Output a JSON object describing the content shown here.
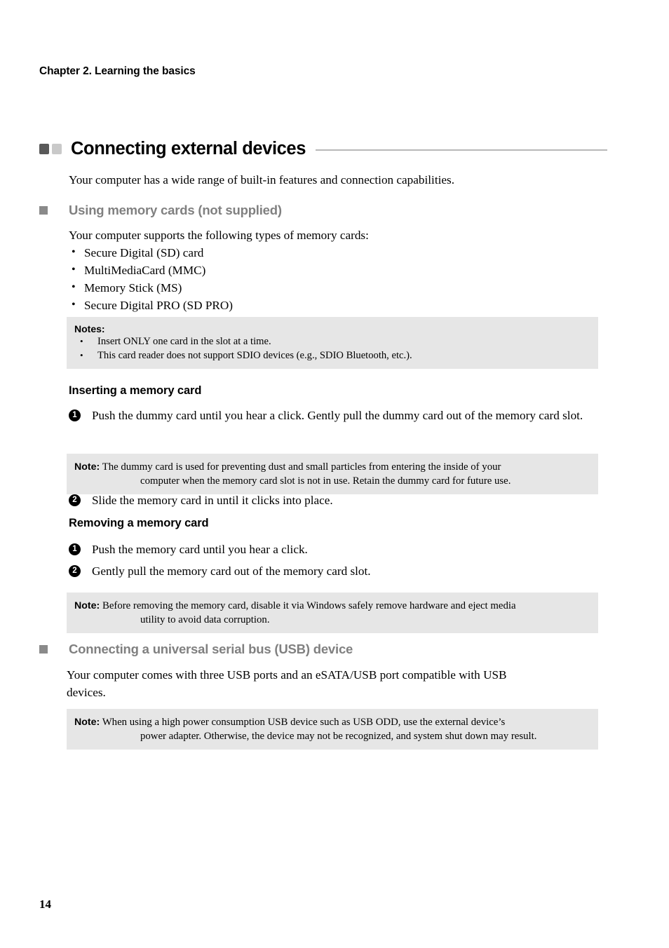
{
  "header": {
    "chapter": "Chapter 2. Learning the basics"
  },
  "title": {
    "text": "Connecting external devices",
    "square_dark_color": "#595959",
    "square_light_color": "#c9c9c9",
    "rule_color": "#b8b8b8"
  },
  "intro": "Your computer has a wide range of built-in features and connection capabilities.",
  "section_memory": {
    "heading": "Using memory cards (not supplied)",
    "heading_color": "#808080",
    "intro": "Your computer supports the following types of memory cards:",
    "cards": [
      "Secure Digital (SD) card",
      "MultiMediaCard (MMC)",
      "Memory Stick (MS)",
      "Secure Digital PRO (SD PRO)"
    ],
    "notes_box": {
      "title": "Notes:",
      "items": [
        "Insert ONLY one card in the slot at a time.",
        "This card reader does not support SDIO devices (e.g., SDIO Bluetooth, etc.)."
      ],
      "background": "#e6e6e6"
    },
    "inserting": {
      "heading": "Inserting a memory card",
      "steps": [
        {
          "num": "1",
          "text": "Push the dummy card until you hear a click. Gently pull the dummy card out of the memory card slot."
        },
        {
          "num": "2",
          "text": "Slide the memory card in until it clicks into place."
        }
      ],
      "note": {
        "label": "Note:",
        "line1": "The dummy card is used for preventing dust and small particles from entering the inside of your",
        "line2": "computer when the memory card slot is not in use. Retain the dummy card for future use."
      }
    },
    "removing": {
      "heading": "Removing a memory card",
      "steps": [
        {
          "num": "1",
          "text": "Push the memory card until you hear a click."
        },
        {
          "num": "2",
          "text": "Gently pull the memory card out of the memory card slot."
        }
      ],
      "note": {
        "label": "Note:",
        "line1": "Before removing the memory card, disable it via Windows safely remove hardware and eject media",
        "line2": "utility to avoid data corruption."
      }
    }
  },
  "section_usb": {
    "heading": "Connecting a universal serial bus (USB) device",
    "body_line1": "Your computer comes with three USB ports and an eSATA/USB port compatible with USB",
    "body_line2": "devices.",
    "note": {
      "label": "Note:",
      "line1": "When using a high power consumption USB device such as USB ODD, use the external device’s",
      "line2": "power adapter. Otherwise, the device may not be recognized, and system shut down may result."
    }
  },
  "footer": {
    "page_number": "14"
  }
}
